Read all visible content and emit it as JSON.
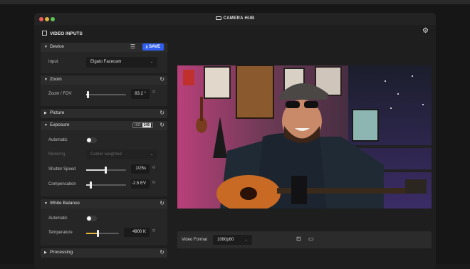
{
  "window": {
    "title": "CAMERA HUB"
  },
  "header": {
    "title": "VIDEO INPUTS"
  },
  "sections": {
    "device": {
      "label": "Device",
      "save_label": "SAVE",
      "input_label": "Input",
      "input_value": "Elgato Facecam"
    },
    "zoom": {
      "label": "Zoom",
      "field_label": "Zoom / FOV",
      "value": "83.2 °",
      "level": 0.03
    },
    "picture": {
      "label": "Picture"
    },
    "exposure": {
      "label": "Exposure",
      "iso_label": "ISO",
      "iso_value": "146",
      "automatic_label": "Automatic",
      "automatic_on": false,
      "metering_label": "Metering",
      "metering_value": "Center weighted",
      "shutter_label": "Shutter Speed",
      "shutter_value": "1/25s",
      "shutter_level": 0.48,
      "compensation_label": "Compensation",
      "compensation_value": "-2.5 EV",
      "compensation_level": 0.1
    },
    "white_balance": {
      "label": "White Balance",
      "automatic_label": "Automatic",
      "automatic_on": false,
      "temperature_label": "Temperature",
      "temperature_value": "4900 K",
      "temperature_level": 0.35
    },
    "processing": {
      "label": "Processing"
    }
  },
  "bottom": {
    "video_format_label": "Video Format",
    "video_format_value": "1080p60"
  },
  "colors": {
    "accent": "#2f5ef0",
    "temperature_fill": "#e8b63a"
  }
}
